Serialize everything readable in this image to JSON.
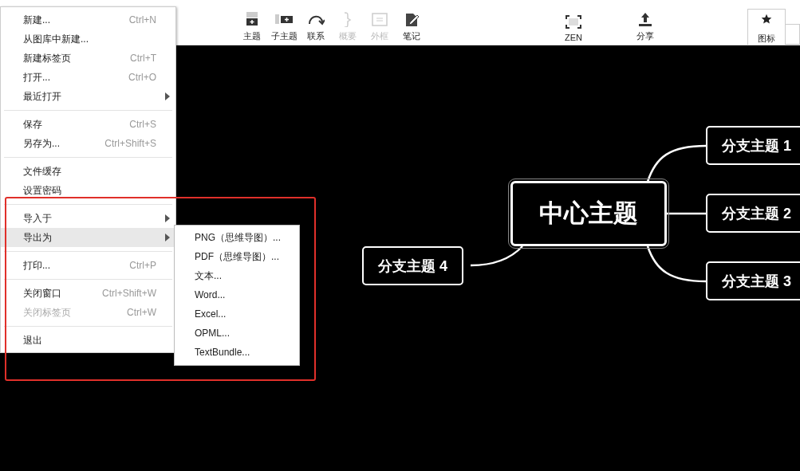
{
  "toolbar": {
    "buttons": [
      {
        "kind": "topic",
        "label": "主题",
        "disabled": false
      },
      {
        "kind": "subtopic",
        "label": "子主题",
        "disabled": false
      },
      {
        "kind": "relation",
        "label": "联系",
        "disabled": false
      },
      {
        "kind": "summary",
        "label": "概要",
        "disabled": true
      },
      {
        "kind": "boundary",
        "label": "外框",
        "disabled": true
      },
      {
        "kind": "note",
        "label": "笔记",
        "disabled": false
      }
    ],
    "center_buttons": [
      {
        "kind": "zen",
        "label": "ZEN",
        "disabled": false
      },
      {
        "kind": "share",
        "label": "分享",
        "disabled": false
      }
    ],
    "panel_tab": {
      "label": "图标",
      "selected": true
    }
  },
  "file_menu": {
    "items": [
      {
        "kind": "item",
        "label": "新建...",
        "shortcut": "Ctrl+N",
        "submenu": false,
        "disabled": false,
        "selected": false
      },
      {
        "kind": "item",
        "label": "从图库中新建...",
        "submenu": false,
        "disabled": false,
        "selected": false
      },
      {
        "kind": "item",
        "label": "新建标签页",
        "shortcut": "Ctrl+T",
        "submenu": false,
        "disabled": false,
        "selected": false
      },
      {
        "kind": "item",
        "label": "打开...",
        "shortcut": "Ctrl+O",
        "submenu": false,
        "disabled": false,
        "selected": false
      },
      {
        "kind": "item",
        "label": "最近打开",
        "submenu": true,
        "disabled": false,
        "selected": false
      },
      {
        "kind": "separator"
      },
      {
        "kind": "item",
        "label": "保存",
        "shortcut": "Ctrl+S",
        "submenu": false,
        "disabled": false,
        "selected": false
      },
      {
        "kind": "item",
        "label": "另存为...",
        "shortcut": "Ctrl+Shift+S",
        "submenu": false,
        "disabled": false,
        "selected": false
      },
      {
        "kind": "separator"
      },
      {
        "kind": "item",
        "label": "文件缓存",
        "submenu": false,
        "disabled": false,
        "selected": false
      },
      {
        "kind": "item",
        "label": "设置密码",
        "submenu": false,
        "disabled": false,
        "selected": false
      },
      {
        "kind": "separator"
      },
      {
        "kind": "item",
        "label": "导入于",
        "submenu": true,
        "disabled": false,
        "selected": false
      },
      {
        "kind": "item",
        "label": "导出为",
        "submenu": true,
        "disabled": false,
        "selected": true
      },
      {
        "kind": "separator"
      },
      {
        "kind": "item",
        "label": "打印...",
        "shortcut": "Ctrl+P",
        "submenu": false,
        "disabled": false,
        "selected": false
      },
      {
        "kind": "separator"
      },
      {
        "kind": "item",
        "label": "关闭窗口",
        "shortcut": "Ctrl+Shift+W",
        "submenu": false,
        "disabled": false,
        "selected": false
      },
      {
        "kind": "item",
        "label": "关闭标签页",
        "shortcut": "Ctrl+W",
        "submenu": false,
        "disabled": true,
        "selected": false
      },
      {
        "kind": "separator"
      },
      {
        "kind": "item",
        "label": "退出",
        "submenu": false,
        "disabled": false,
        "selected": false
      }
    ]
  },
  "export_submenu": {
    "items": [
      {
        "label": "PNG（思维导图）..."
      },
      {
        "label": "PDF（思维导图）..."
      },
      {
        "label": "文本..."
      },
      {
        "label": "Word..."
      },
      {
        "label": "Excel..."
      },
      {
        "label": "OPML..."
      },
      {
        "label": "TextBundle..."
      }
    ]
  },
  "mind_map": {
    "central_topic": "中心主题",
    "right_branches": [
      {
        "label": "分支主题 1"
      },
      {
        "label": "分支主题 2"
      },
      {
        "label": "分支主题 3"
      }
    ],
    "left_branches": [
      {
        "label": "分支主题 4"
      }
    ]
  }
}
